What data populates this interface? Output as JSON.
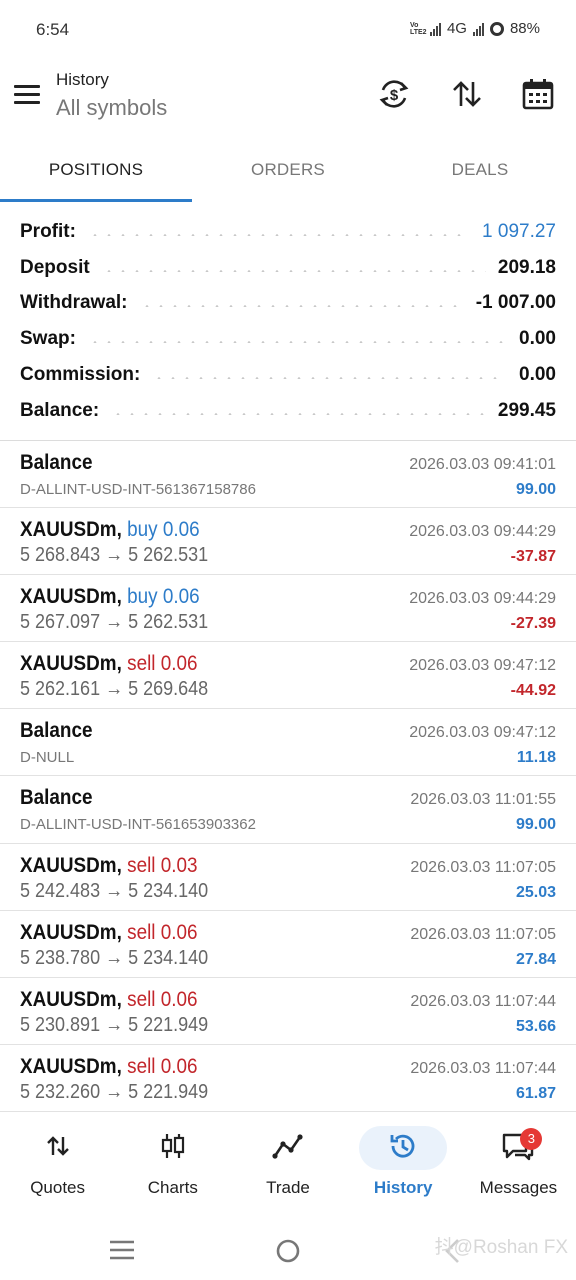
{
  "status_bar": {
    "time": "6:54",
    "volte": "Vo LTE2",
    "network": "4G",
    "battery": "88%"
  },
  "header": {
    "title": "History",
    "subtitle": "All symbols",
    "icons": [
      "currency-swap-icon",
      "sort-icon",
      "calendar-icon"
    ]
  },
  "tabs": [
    {
      "label": "POSITIONS",
      "active": true
    },
    {
      "label": "ORDERS",
      "active": false
    },
    {
      "label": "DEALS",
      "active": false
    }
  ],
  "summary": {
    "profit": {
      "label": "Profit:",
      "value": "1 097.27"
    },
    "deposit": {
      "label": "Deposit",
      "value": "209.18"
    },
    "withdrawal": {
      "label": "Withdrawal:",
      "value": "-1 007.00"
    },
    "swap": {
      "label": "Swap:",
      "value": "0.00"
    },
    "commission": {
      "label": "Commission:",
      "value": "0.00"
    },
    "balance": {
      "label": "Balance:",
      "value": "299.45"
    }
  },
  "deals": [
    {
      "title": "Balance",
      "dir": "",
      "sub": "D-ALLINT-USD-INT-561367158786",
      "time": "2026.03.03 09:41:01",
      "amount": "99.00",
      "positive": true
    },
    {
      "title": "XAUUSDm,",
      "dir": "buy 0.06",
      "side": "buy",
      "sub": "5 268.843 → 5 262.531",
      "time": "2026.03.03 09:44:29",
      "amount": "-37.87",
      "positive": false
    },
    {
      "title": "XAUUSDm,",
      "dir": "buy 0.06",
      "side": "buy",
      "sub": "5 267.097 → 5 262.531",
      "time": "2026.03.03 09:44:29",
      "amount": "-27.39",
      "positive": false
    },
    {
      "title": "XAUUSDm,",
      "dir": "sell 0.06",
      "side": "sell",
      "sub": "5 262.161 → 5 269.648",
      "time": "2026.03.03 09:47:12",
      "amount": "-44.92",
      "positive": false
    },
    {
      "title": "Balance",
      "dir": "",
      "sub": "D-NULL",
      "time": "2026.03.03 09:47:12",
      "amount": "11.18",
      "positive": true
    },
    {
      "title": "Balance",
      "dir": "",
      "sub": "D-ALLINT-USD-INT-561653903362",
      "time": "2026.03.03 11:01:55",
      "amount": "99.00",
      "positive": true
    },
    {
      "title": "XAUUSDm,",
      "dir": "sell 0.03",
      "side": "sell",
      "sub": "5 242.483 → 5 234.140",
      "time": "2026.03.03 11:07:05",
      "amount": "25.03",
      "positive": true
    },
    {
      "title": "XAUUSDm,",
      "dir": "sell 0.06",
      "side": "sell",
      "sub": "5 238.780 → 5 234.140",
      "time": "2026.03.03 11:07:05",
      "amount": "27.84",
      "positive": true
    },
    {
      "title": "XAUUSDm,",
      "dir": "sell 0.06",
      "side": "sell",
      "sub": "5 230.891 → 5 221.949",
      "time": "2026.03.03 11:07:44",
      "amount": "53.66",
      "positive": true
    },
    {
      "title": "XAUUSDm,",
      "dir": "sell 0.06",
      "side": "sell",
      "sub": "5 232.260 → 5 221.949",
      "time": "2026.03.03 11:07:44",
      "amount": "61.87",
      "positive": true
    }
  ],
  "bottom_nav": {
    "quotes": "Quotes",
    "charts": "Charts",
    "trade": "Trade",
    "history": "History",
    "messages": "Messages",
    "messages_badge": "3"
  },
  "watermark": "抖@Roshan FX",
  "colors": {
    "accent": "#2d7cc9",
    "negative": "#c2262b",
    "badge": "#e53935"
  }
}
